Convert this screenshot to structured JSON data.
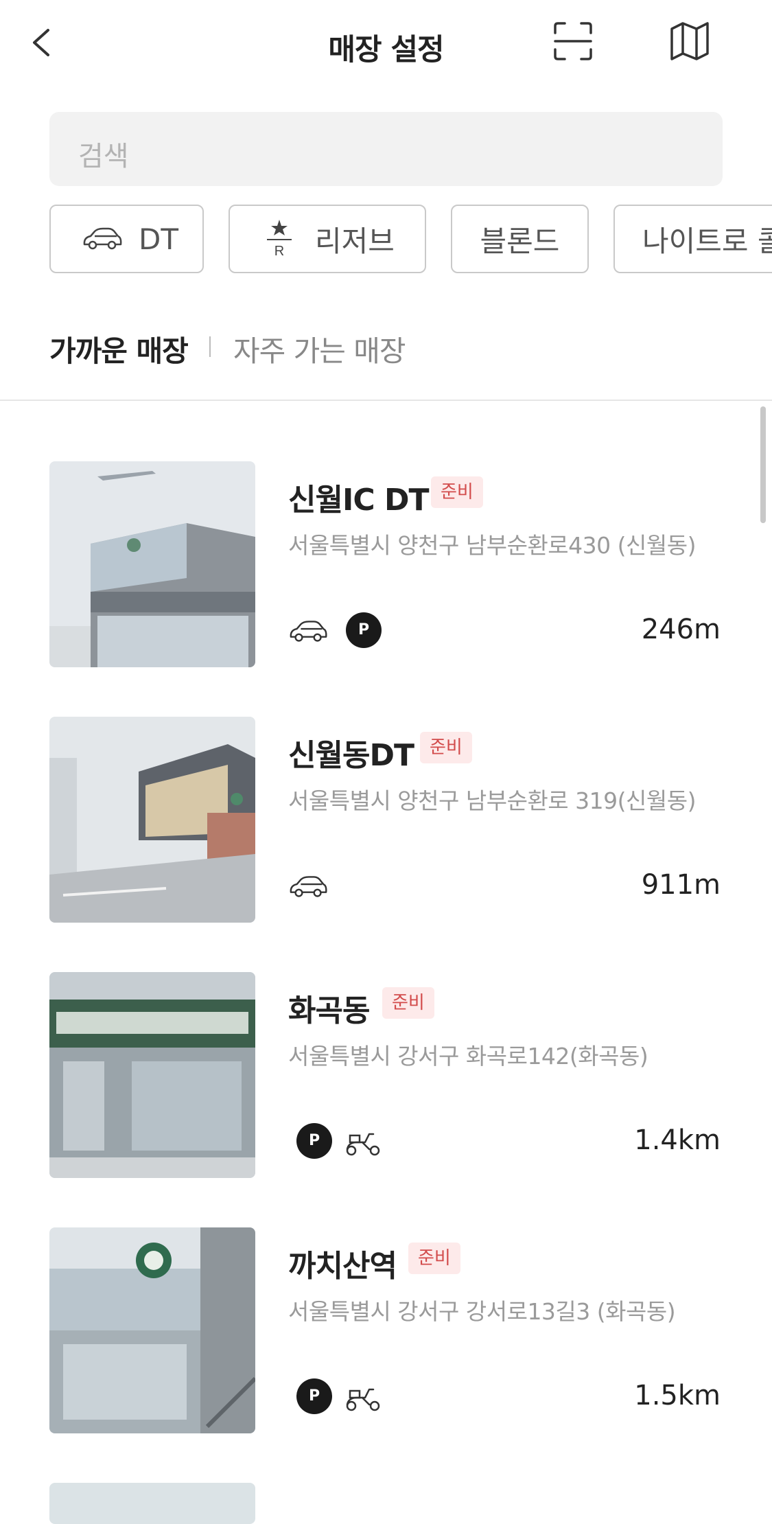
{
  "header": {
    "title": "매장 설정",
    "back_icon": "chevron-left-icon",
    "scan_icon": "scan-frame-icon",
    "map_icon": "map-icon"
  },
  "search": {
    "placeholder": "검색"
  },
  "filters": [
    {
      "label": "DT",
      "icon": "car-icon"
    },
    {
      "label": "리저브",
      "icon": "reserve-star-icon",
      "icon_letter": "R"
    },
    {
      "label": "블론드"
    },
    {
      "label": "나이트로 콜"
    }
  ],
  "tabs": {
    "active": "가까운 매장",
    "inactive": "자주 가는 매장"
  },
  "stores": [
    {
      "name": "신월IC DT",
      "badge": "준비",
      "address": "서울특별시 양천구 남부순환로430 (신월동)",
      "features": [
        "drive-thru",
        "parking"
      ],
      "parking_label": "P",
      "distance": "246m"
    },
    {
      "name": "신월동DT",
      "badge": "준비",
      "address": "서울특별시 양천구 남부순환로 319(신월동)",
      "features": [
        "drive-thru"
      ],
      "distance": "911m"
    },
    {
      "name": "화곡동",
      "badge": "준비",
      "address": "서울특별시 강서구 화곡로142(화곡동)",
      "features": [
        "parking",
        "delivery"
      ],
      "parking_label": "P",
      "distance": "1.4km"
    },
    {
      "name": "까치산역",
      "badge": "준비",
      "address": "서울특별시 강서구 강서로13길3 (화곡동)",
      "features": [
        "parking",
        "delivery"
      ],
      "parking_label": "P",
      "distance": "1.5km"
    }
  ],
  "colors": {
    "badge_bg": "#fdeaea",
    "badge_text": "#d24b4b",
    "address": "#9a9a9a",
    "chip_border": "#c9c9c9"
  }
}
